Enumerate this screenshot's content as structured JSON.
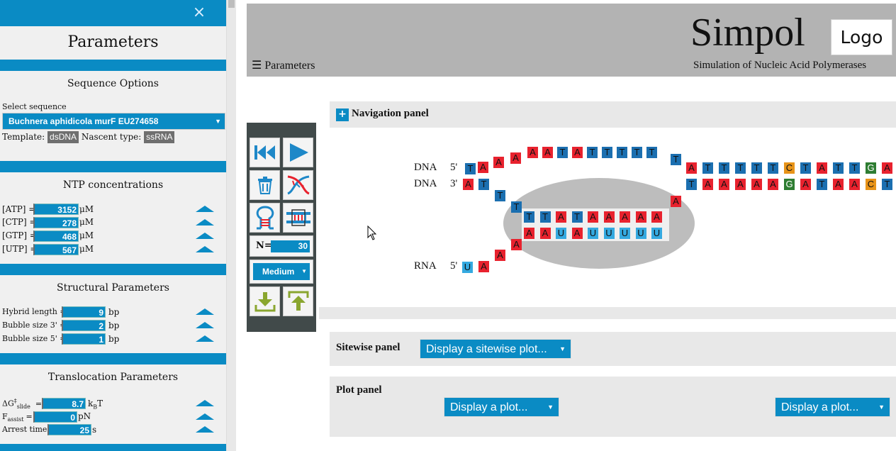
{
  "sidebar": {
    "close_symbol": "×",
    "title": "Parameters",
    "sequence_options": {
      "heading": "Sequence Options",
      "select_label": "Select sequence",
      "selected_sequence": "Buchnera aphidicola murF EU274658",
      "template_label": "Template:",
      "template_value": "dsDNA",
      "nascent_label": "Nascent type:",
      "nascent_value": "ssRNA"
    },
    "ntp": {
      "heading": "NTP concentrations",
      "unit": "μM",
      "rows": [
        {
          "label": "[ATP] =",
          "value": "3152"
        },
        {
          "label": "[CTP] =",
          "value": "278"
        },
        {
          "label": "[GTP] =",
          "value": "468"
        },
        {
          "label": "[UTP] =",
          "value": "567"
        }
      ]
    },
    "structural": {
      "heading": "Structural Parameters",
      "unit": "bp",
      "rows": [
        {
          "label": "Hybrid length =",
          "value": "9"
        },
        {
          "label": "Bubble size 3' =",
          "value": "2"
        },
        {
          "label": "Bubble size 5' =",
          "value": "1"
        }
      ]
    },
    "translocation": {
      "heading": "Translocation Parameters",
      "dg_label": "ΔG",
      "dg_sup": "‡",
      "dg_sub": "slide",
      "dg_eq": "=",
      "dg_value": "8.7",
      "dg_unit_main": "k",
      "dg_unit_sub": "B",
      "dg_unit_tail": "T",
      "f_label": "F",
      "f_sub": "assist",
      "f_eq": "=",
      "f_value": "0",
      "f_unit": "pN",
      "arrest_label": "Arrest time:",
      "arrest_value": "25",
      "arrest_unit": "s"
    }
  },
  "header": {
    "menu_glyph": "☰",
    "menu_label": "Parameters",
    "title": "Simpol",
    "logo": "Logo",
    "subtitle": "Simulation of Nucleic Acid Polymerases"
  },
  "navigation_panel": {
    "toggle_symbol": "+",
    "title": "Navigation panel"
  },
  "toolbar": {
    "n_label": "N=",
    "n_value": "30",
    "speed_value": "Medium"
  },
  "strand_labels": {
    "dna_top": "DNA",
    "dna_top_end": "5'",
    "dna_bottom": "DNA",
    "dna_bottom_end": "3'",
    "rna": "RNA",
    "rna_end": "5'"
  },
  "sequences": {
    "template_top_left": "TAA",
    "template_top_bubble": "AAATATTTTTT",
    "template_top_right": "ATTTTTCTATTGA",
    "template_bottom_left": "AT",
    "template_bottom_bubble": "TTA",
    "template_bottom_right": "TAAAAAGATAACT",
    "hybrid_dna": "TTATAAAAA",
    "hybrid_rna": "AAUAUUUUU",
    "rna_tail": "UAAA"
  },
  "colors": {
    "accent": "#0a8bc4",
    "A": "#e8222e",
    "T": "#1b6fb0",
    "U": "#34a9e0",
    "G": "#2e7d32",
    "C": "#e89419"
  },
  "sitewise_panel": {
    "title": "Sitewise panel",
    "select_value": "Display a sitewise plot..."
  },
  "plot_panel": {
    "title": "Plot panel",
    "select_left": "Display a plot...",
    "select_right": "Display a plot..."
  }
}
